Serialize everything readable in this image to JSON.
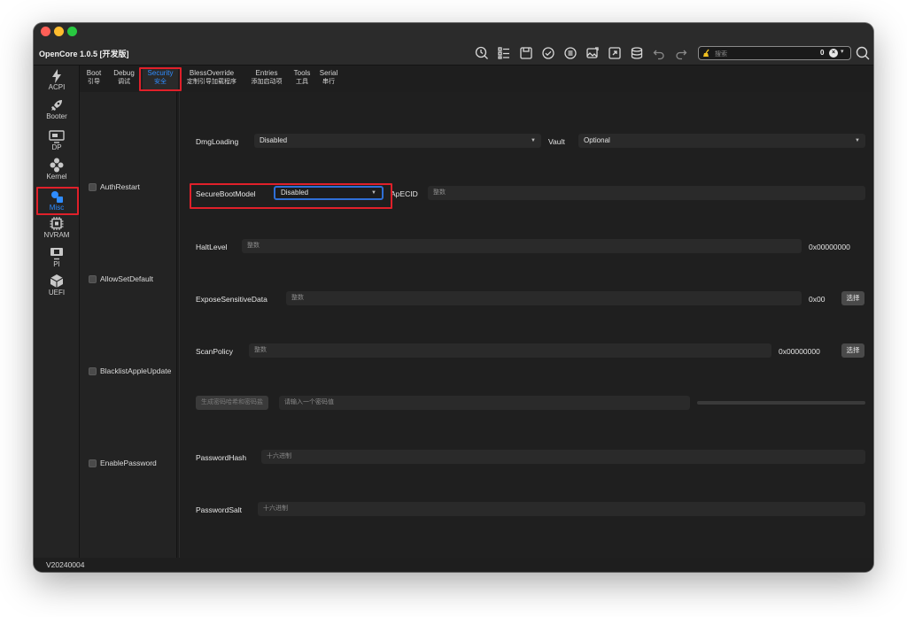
{
  "app": {
    "title": "OpenCore 1.0.5 [开发版]",
    "version": "V20240004"
  },
  "search": {
    "placeholder": "搜索",
    "count": "0",
    "clear": "×",
    "dropdown": "▾"
  },
  "colors": {
    "accent": "#2f8cff",
    "highlight": "#e0202a",
    "traffic_red": "#ff5f57",
    "traffic_yellow": "#febc2e",
    "traffic_green": "#28c840"
  },
  "toolbar_icons": [
    "clock-search-icon",
    "list-icon",
    "save-icon",
    "check-circle-icon",
    "list-circle-icon",
    "image-export-icon",
    "export-icon",
    "database-icon",
    "undo-icon",
    "redo-icon"
  ],
  "sidebar": {
    "items": [
      {
        "label": "ACPI",
        "icon": "lightning-icon"
      },
      {
        "label": "Booter",
        "icon": "rocket-icon"
      },
      {
        "label": "DP",
        "icon": "display-icon"
      },
      {
        "label": "Kernel",
        "icon": "kernel-icon"
      },
      {
        "label": "Misc",
        "icon": "misc-icon"
      },
      {
        "label": "NVRAM",
        "icon": "chip-icon"
      },
      {
        "label": "PI",
        "icon": "monitor-icon"
      },
      {
        "label": "UEFI",
        "icon": "cube-icon"
      }
    ]
  },
  "tabs": [
    {
      "en": "Boot",
      "cn": "引导"
    },
    {
      "en": "Debug",
      "cn": "调试"
    },
    {
      "en": "Security",
      "cn": "安全"
    },
    {
      "en": "BlessOverride",
      "cn": "定制引导加载程序"
    },
    {
      "en": "Entries",
      "cn": "添加启动项"
    },
    {
      "en": "Tools",
      "cn": "工具"
    },
    {
      "en": "Serial",
      "cn": "串行"
    }
  ],
  "checkboxes": {
    "auth_restart": "AuthRestart",
    "allow_set_default": "AllowSetDefault",
    "blacklist_apple_update": "BlacklistAppleUpdate",
    "enable_password": "EnablePassword"
  },
  "form": {
    "dmg_loading": {
      "label": "DmgLoading",
      "value": "Disabled"
    },
    "vault": {
      "label": "Vault",
      "value": "Optional"
    },
    "secure_boot_model": {
      "label": "SecureBootModel",
      "value": "Disabled"
    },
    "ap_ecid": {
      "label": "ApECID",
      "placeholder": "整数"
    },
    "halt_level": {
      "label": "HaltLevel",
      "placeholder": "整数",
      "hex": "0x00000000"
    },
    "expose_sensitive_data": {
      "label": "ExposeSensitiveData",
      "placeholder": "整数",
      "hex": "0x00",
      "button": "选择"
    },
    "scan_policy": {
      "label": "ScanPolicy",
      "placeholder": "整数",
      "hex": "0x00000000",
      "button": "选择"
    },
    "password_gen": {
      "button": "生成密码哈希和密码盐",
      "placeholder": "请输入一个密码值"
    },
    "password_hash": {
      "label": "PasswordHash",
      "placeholder": "十六进制"
    },
    "password_salt": {
      "label": "PasswordSalt",
      "placeholder": "十六进制"
    }
  }
}
